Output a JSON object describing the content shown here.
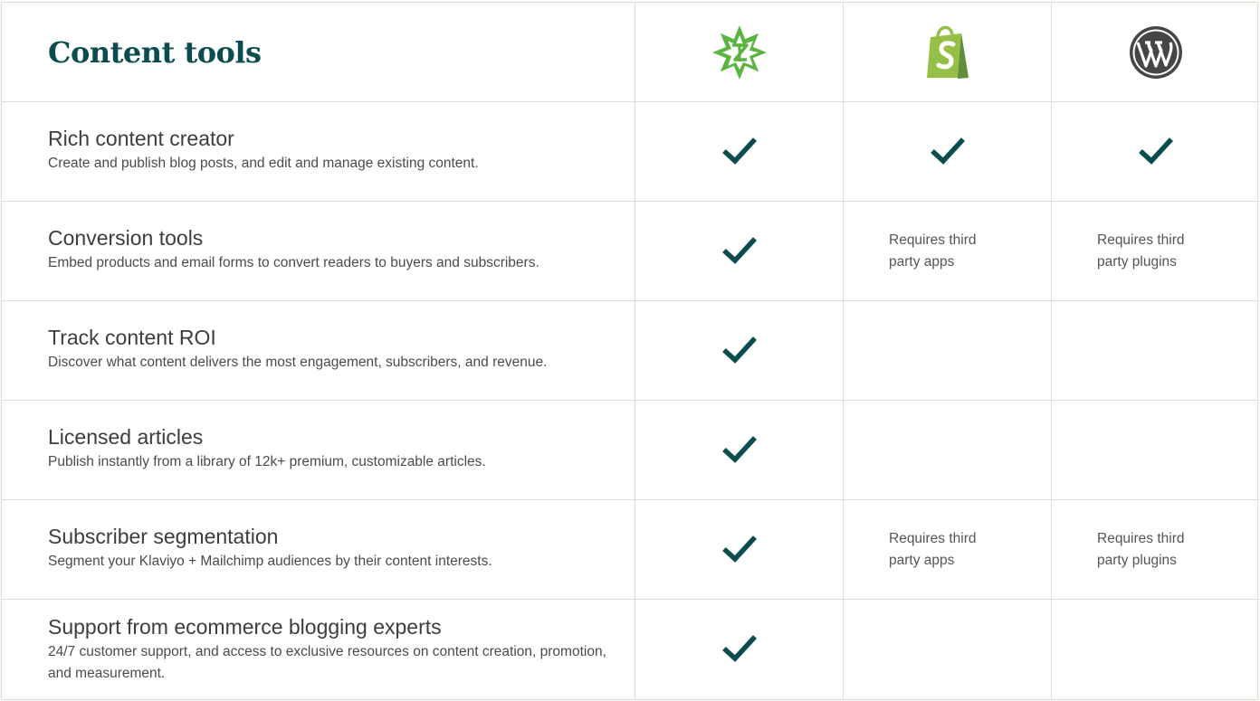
{
  "header": {
    "title": "Content tools",
    "columns": [
      {
        "icon": "star-burst-logo-icon",
        "color": "#5cb440"
      },
      {
        "icon": "shopify-logo-icon",
        "color": "#95bf47"
      },
      {
        "icon": "wordpress-logo-icon",
        "color": "#464646"
      }
    ]
  },
  "colors": {
    "accent": "#0b4d4f",
    "check": "#0b4d4f"
  },
  "rows": [
    {
      "name": "Rich content creator",
      "description": "Create and publish blog posts, and edit and manage existing content.",
      "cols": [
        "check",
        "check",
        "check"
      ]
    },
    {
      "name": "Conversion tools",
      "description": "Embed products and email forms to convert readers to buyers and subscribers.",
      "cols": [
        "check",
        "Requires third party apps",
        "Requires third party plugins"
      ]
    },
    {
      "name": "Track content ROI",
      "description": "Discover what content delivers the most engagement, subscribers, and revenue.",
      "cols": [
        "check",
        "",
        ""
      ]
    },
    {
      "name": "Licensed articles",
      "description": "Publish instantly from a library of 12k+ premium, customizable articles.",
      "cols": [
        "check",
        "",
        ""
      ]
    },
    {
      "name": "Subscriber segmentation",
      "description": "Segment your Klaviyo + Mailchimp audiences by their content interests.",
      "cols": [
        "check",
        "Requires third party apps",
        "Requires third party plugins"
      ]
    },
    {
      "name": "Support from ecommerce blogging experts",
      "description": "24/7 customer support, and access to exclusive resources on content creation, promotion, and measurement.",
      "cols": [
        "check",
        "",
        ""
      ]
    }
  ]
}
